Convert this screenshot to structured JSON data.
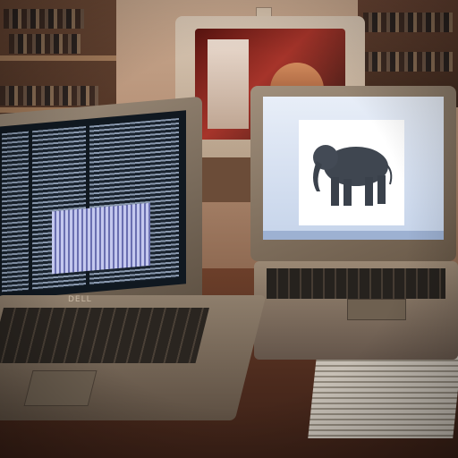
{
  "scene": {
    "description_label": "",
    "left_laptop": {
      "brand_text": "DELL",
      "screen_content": "terminal-text"
    },
    "right_laptop": {
      "banner_text": "",
      "photo_subject": "elephant"
    },
    "tv": {
      "screen_content": "people-scene"
    },
    "colors": {
      "wall": "#b48f75",
      "desk": "#4b2a1d",
      "terminal_bg": "#101820",
      "right_screen_bg": "#c6d4ea",
      "elephant": "#3f4650"
    }
  }
}
